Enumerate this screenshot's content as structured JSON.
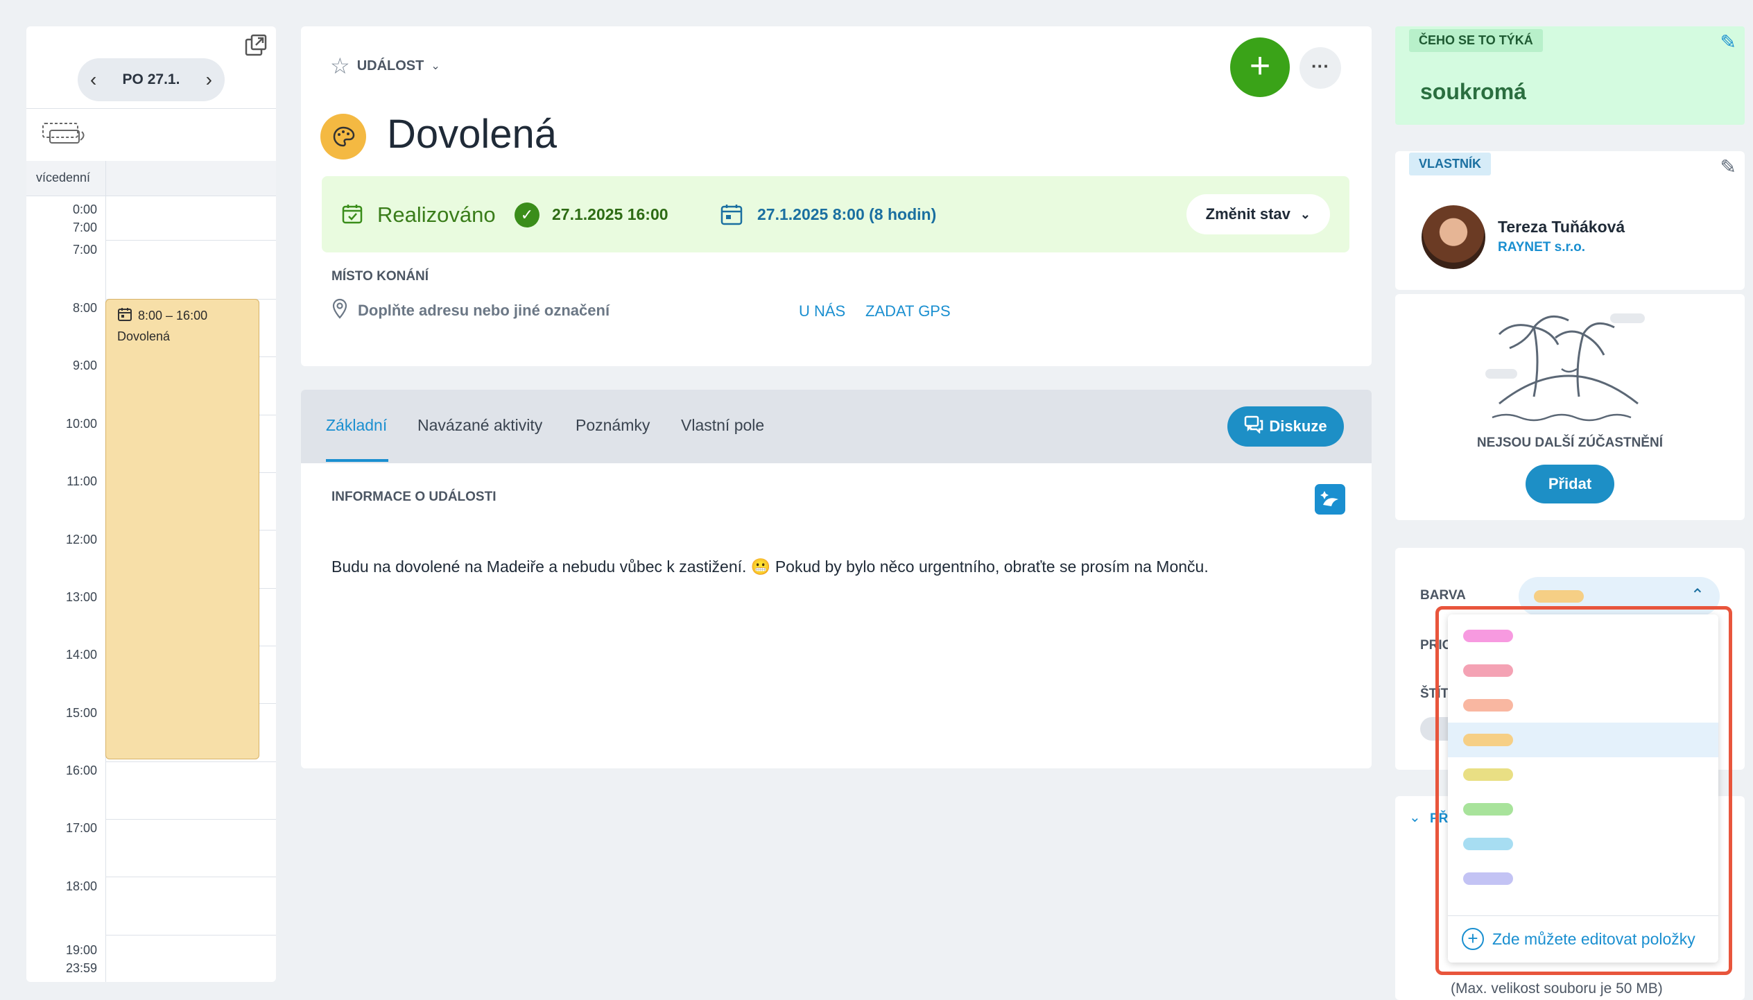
{
  "calendar": {
    "date_label": "PO 27.1.",
    "allday_label": "vícedenní",
    "times": [
      "0:00",
      "7:00",
      "7:00",
      "8:00",
      "9:00",
      "10:00",
      "11:00",
      "12:00",
      "13:00",
      "14:00",
      "15:00",
      "16:00",
      "17:00",
      "18:00",
      "19:00",
      "23:59"
    ],
    "event_time": "8:00 – 16:00",
    "event_title": "Dovolená"
  },
  "event": {
    "type_label": "UDÁLOST",
    "title": "Dovolená",
    "status": "Realizováno",
    "done_date": "27.1.2025 16:00",
    "scheduled": "27.1.2025 8:00 (8 hodin)",
    "change_status": "Změnit stav",
    "location_label": "MÍSTO KONÁNÍ",
    "location_placeholder": "Doplňte adresu nebo jiné označení",
    "at_us": "U NÁS",
    "gps": "ZADAT GPS"
  },
  "tabs": {
    "items": [
      "Základní",
      "Navázané aktivity",
      "Poznámky",
      "Vlastní pole"
    ],
    "discuss": "Diskuze",
    "info_label": "INFORMACE O UDÁLOSTI",
    "description": "Budu na dovolené na Madeiře a nebudu vůbec k zastižení. 😬 Pokud by bylo něco urgentního, obraťte se prosím na Monču."
  },
  "right": {
    "topic_label": "ČEHO SE TO TÝKÁ",
    "topic_value": "soukromá",
    "owner_label": "VLASTNÍK",
    "owner_name": "Tereza Tuňáková",
    "owner_company": "RAYNET s.r.o.",
    "no_participants": "NEJSOU DALŠÍ ZÚČASTNĚNÍ",
    "add_button": "Přidat",
    "color_label": "BARVA",
    "prio_partial": "PRIO",
    "tags_partial": "ŠTÍT",
    "attach_partial": "PŘ",
    "max_size": "(Max. velikost souboru je 50 MB)"
  },
  "dropdown": {
    "colors": [
      "#f79ae0",
      "#f4a2b4",
      "#f9b7a1",
      "#f6cf85",
      "#e9df84",
      "#a8e39b",
      "#a7ddf2",
      "#c3c3f4"
    ],
    "selected_color": "#f6cf85",
    "edit_link": "Zde můžete editovat položky"
  },
  "colors": {
    "accent": "#1a8fd0",
    "green": "#3aa318",
    "status_bg": "#e9fbdf",
    "highlight": "#e4f1fb",
    "red_outline": "#e8553c"
  }
}
